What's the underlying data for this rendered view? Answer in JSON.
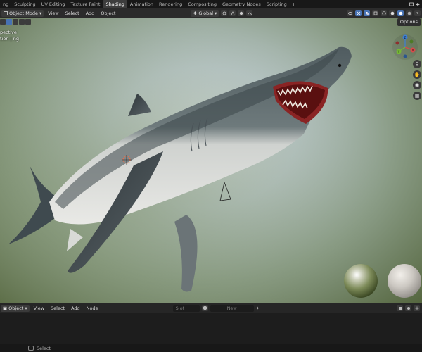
{
  "workspace_tabs": [
    {
      "label": "ng",
      "active": false
    },
    {
      "label": "Sculpting",
      "active": false
    },
    {
      "label": "UV Editing",
      "active": false
    },
    {
      "label": "Texture Paint",
      "active": false
    },
    {
      "label": "Shading",
      "active": true
    },
    {
      "label": "Animation",
      "active": false
    },
    {
      "label": "Rendering",
      "active": false
    },
    {
      "label": "Compositing",
      "active": false
    },
    {
      "label": "Geometry Nodes",
      "active": false
    },
    {
      "label": "Scripting",
      "active": false
    }
  ],
  "workspace_add": "+",
  "viewport_header": {
    "mode": "Object Mode",
    "menus": [
      "View",
      "Select",
      "Add",
      "Object"
    ],
    "transform_orientation": "Global"
  },
  "viewport": {
    "info_line1": "pective",
    "info_line2": "tion | ng",
    "options_label": "Options",
    "gizmo_axes": [
      "X",
      "Y",
      "Z"
    ],
    "nav_icons": [
      "zoom-icon",
      "pan-icon",
      "camera-icon",
      "grid-icon"
    ]
  },
  "node_editor": {
    "object_type": "Object",
    "menus": [
      "View",
      "Select",
      "Add",
      "Node"
    ],
    "slot": "Slot",
    "material_name": "New"
  },
  "status_bar": {
    "select_label": "Select"
  },
  "colors": {
    "active_blue": "#4772b3",
    "axis_x": "#d84a4a",
    "axis_y": "#75b736",
    "axis_z": "#3d7fd6"
  }
}
